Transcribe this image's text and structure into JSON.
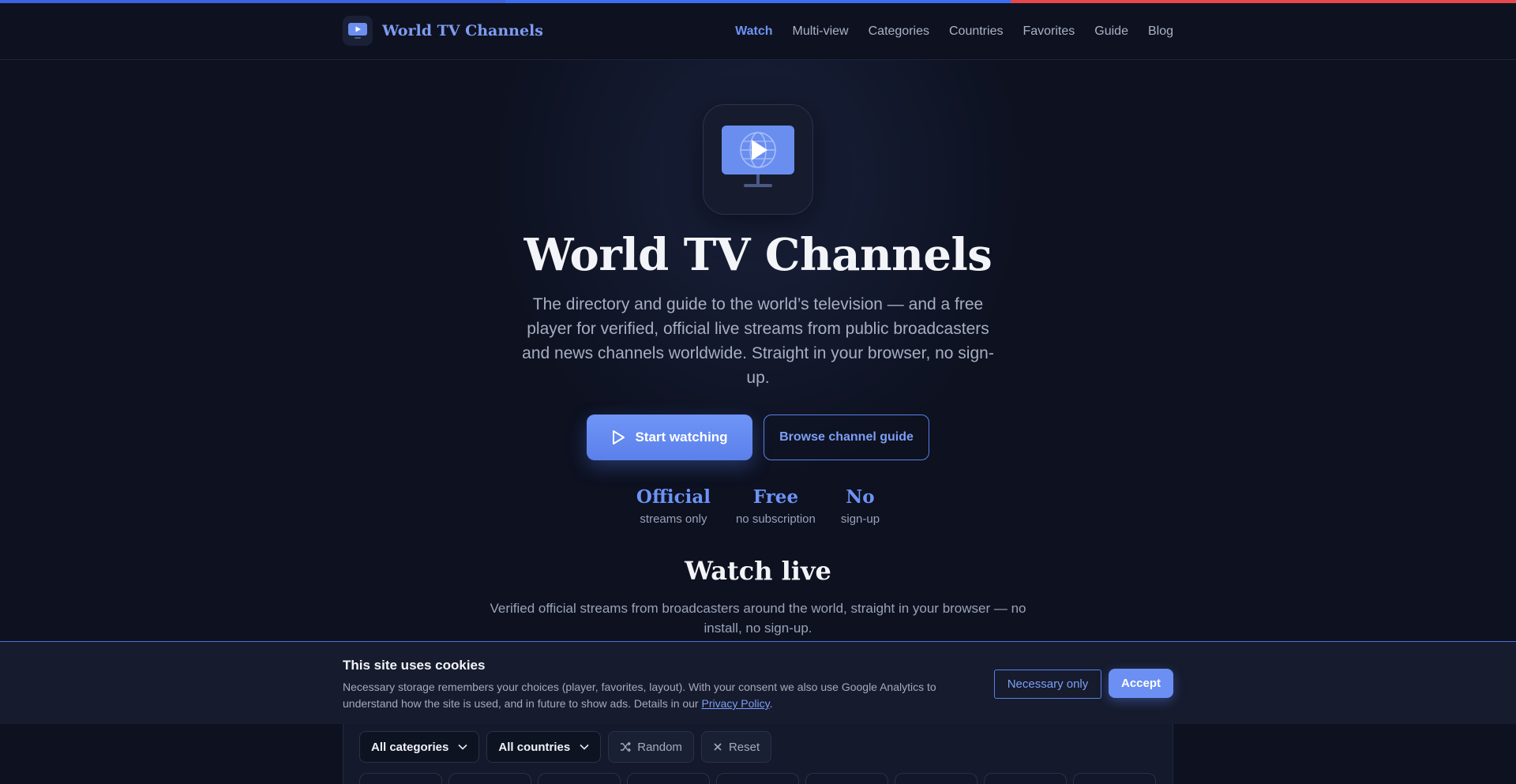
{
  "brand": {
    "name": "World TV Channels"
  },
  "nav": {
    "items": [
      {
        "label": "Watch",
        "active": true
      },
      {
        "label": "Multi-view"
      },
      {
        "label": "Categories"
      },
      {
        "label": "Countries"
      },
      {
        "label": "Favorites"
      },
      {
        "label": "Guide"
      },
      {
        "label": "Blog"
      }
    ]
  },
  "hero": {
    "title": "World TV Channels",
    "lead": "The directory and guide to the world’s television — and a free player for verified, official live streams from public broadcasters and news channels worldwide. Straight in your browser, no sign-up.",
    "primary_cta": "Start watching",
    "secondary_cta": "Browse channel guide",
    "stats": [
      {
        "value": "Official",
        "label": "streams only"
      },
      {
        "value": "Free",
        "label": "no subscription"
      },
      {
        "value": "No",
        "label": "sign-up"
      }
    ]
  },
  "watch": {
    "title": "Watch live",
    "subtitle": "Verified official streams from broadcasters around the world, straight in your browser — no install, no sign-up."
  },
  "cookie": {
    "title": "This site uses cookies",
    "text_before": "Necessary storage remembers your choices (player, favorites, layout). With your consent we also use Google Analytics to understand how the site is used, and in future to show ads. Details in our ",
    "link": "Privacy Policy",
    "text_after": ".",
    "necessary_label": "Necessary only",
    "accept_label": "Accept"
  },
  "filters": {
    "categories": "All categories",
    "countries": "All countries",
    "random": "Random",
    "reset": "Reset"
  },
  "colors": {
    "accent": "#6d93f5",
    "background": "#0d1120",
    "top_stripe": [
      "#3b63e0",
      "#3b6ef0",
      "#e5484d"
    ]
  },
  "icons": {
    "logo": "tv-play-icon",
    "hero": "tv-globe-play-icon",
    "cta": "play-icon",
    "select": "chevron-down-icon",
    "random": "shuffle-icon",
    "reset": "close-icon"
  }
}
